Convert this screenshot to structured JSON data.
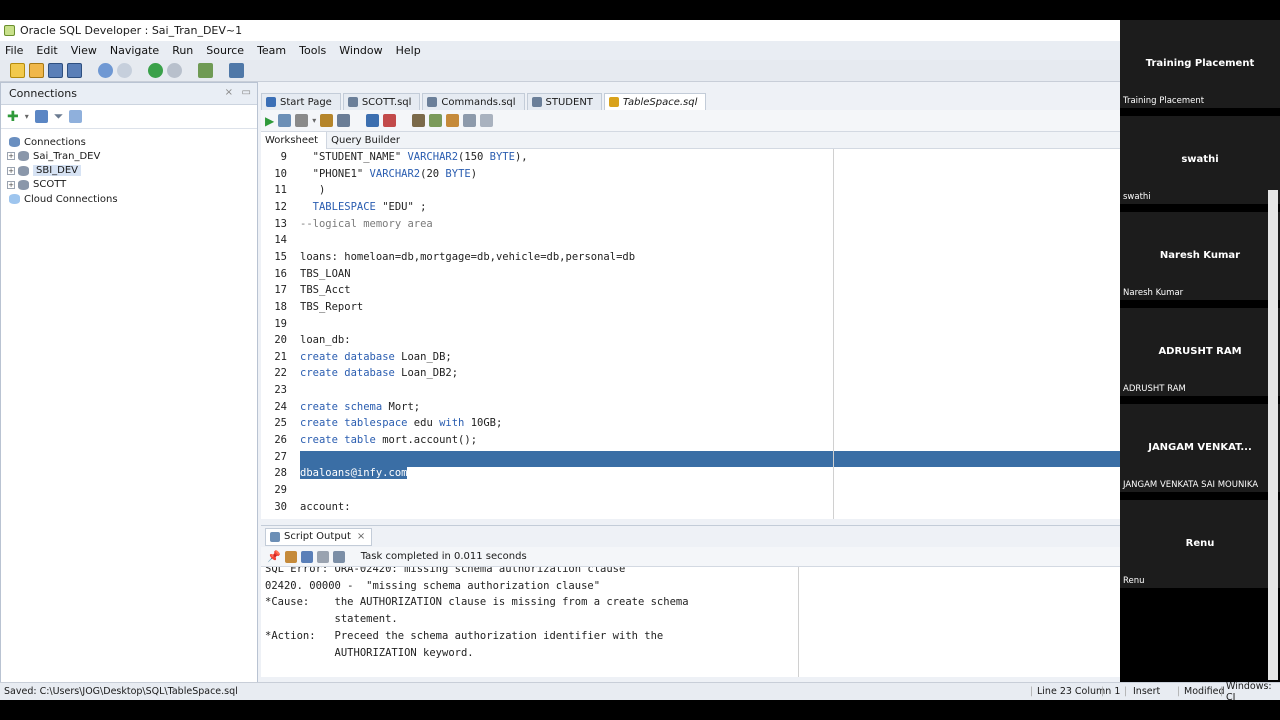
{
  "window": {
    "title": "Oracle SQL Developer : Sai_Tran_DEV~1"
  },
  "menu": [
    "File",
    "Edit",
    "View",
    "Navigate",
    "Run",
    "Source",
    "Team",
    "Tools",
    "Window",
    "Help"
  ],
  "connections_panel": {
    "title": "Connections",
    "tree": [
      {
        "label": "Connections",
        "level": 0
      },
      {
        "label": "Sai_Tran_DEV",
        "level": 1
      },
      {
        "label": "SBI_DEV",
        "level": 1,
        "selected": true
      },
      {
        "label": "SCOTT",
        "level": 1
      },
      {
        "label": "Cloud Connections",
        "level": 0
      }
    ]
  },
  "editor_tabs": [
    {
      "label": "Start Page",
      "icon_color": "#3b6fb6"
    },
    {
      "label": "SCOTT.sql",
      "icon_color": "#6b7f99"
    },
    {
      "label": "Commands.sql",
      "icon_color": "#6b7f99"
    },
    {
      "label": "STUDENT",
      "icon_color": "#6b7f99"
    },
    {
      "label": "TableSpace.sql",
      "icon_color": "#d9a21b",
      "active": true
    }
  ],
  "subtabs": {
    "worksheet": "Worksheet",
    "query_builder": "Query Builder"
  },
  "editor": {
    "lines": [
      {
        "n": "9",
        "parts": [
          {
            "t": "  \"STUDENT_NAME\" "
          },
          {
            "t": "VARCHAR2",
            "c": "kw"
          },
          {
            "t": "(150 "
          },
          {
            "t": "BYTE",
            "c": "kw"
          },
          {
            "t": "),"
          }
        ]
      },
      {
        "n": "10",
        "parts": [
          {
            "t": "  \"PHONE1\" "
          },
          {
            "t": "VARCHAR2",
            "c": "kw"
          },
          {
            "t": "(20 "
          },
          {
            "t": "BYTE",
            "c": "kw"
          },
          {
            "t": ")"
          }
        ]
      },
      {
        "n": "11",
        "parts": [
          {
            "t": "   )"
          }
        ]
      },
      {
        "n": "12",
        "parts": [
          {
            "t": "  "
          },
          {
            "t": "TABLESPACE",
            "c": "kw"
          },
          {
            "t": " \"EDU\" ;"
          }
        ]
      },
      {
        "n": "13",
        "parts": [
          {
            "t": "--logical memory area",
            "c": "cmt"
          }
        ]
      },
      {
        "n": "14",
        "parts": [
          {
            "t": ""
          }
        ]
      },
      {
        "n": "15",
        "parts": [
          {
            "t": "loans: homeloan=db,mortgage=db,vehicle=db,personal=db"
          }
        ]
      },
      {
        "n": "16",
        "parts": [
          {
            "t": "TBS_LOAN"
          }
        ]
      },
      {
        "n": "17",
        "parts": [
          {
            "t": "TBS_Acct"
          }
        ]
      },
      {
        "n": "18",
        "parts": [
          {
            "t": "TBS_Report"
          }
        ]
      },
      {
        "n": "19",
        "parts": [
          {
            "t": ""
          }
        ]
      },
      {
        "n": "20",
        "parts": [
          {
            "t": "loan_db:"
          }
        ]
      },
      {
        "n": "21",
        "parts": [
          {
            "t": "create",
            "c": "kw"
          },
          {
            "t": " "
          },
          {
            "t": "database",
            "c": "kw"
          },
          {
            "t": " Loan_DB;"
          }
        ]
      },
      {
        "n": "22",
        "parts": [
          {
            "t": "create",
            "c": "kw"
          },
          {
            "t": " "
          },
          {
            "t": "database",
            "c": "kw"
          },
          {
            "t": " Loan_DB2;"
          }
        ]
      },
      {
        "n": "23",
        "parts": [
          {
            "t": ""
          }
        ]
      },
      {
        "n": "24",
        "parts": [
          {
            "t": "create",
            "c": "kw"
          },
          {
            "t": " "
          },
          {
            "t": "schema",
            "c": "kw"
          },
          {
            "t": " Mort;"
          }
        ]
      },
      {
        "n": "25",
        "parts": [
          {
            "t": "create",
            "c": "kw"
          },
          {
            "t": " "
          },
          {
            "t": "tablespace",
            "c": "kw"
          },
          {
            "t": " edu "
          },
          {
            "t": "with",
            "c": "kw"
          },
          {
            "t": " 10GB;"
          }
        ]
      },
      {
        "n": "26",
        "parts": [
          {
            "t": "create",
            "c": "kw"
          },
          {
            "t": " "
          },
          {
            "t": "table",
            "c": "kw"
          },
          {
            "t": " mort.account();"
          }
        ]
      },
      {
        "n": "27",
        "parts": [
          {
            "t": ""
          }
        ],
        "highlight": true
      },
      {
        "n": "28",
        "parts": [
          {
            "t": "dbaloans@infy.com",
            "c": "selcode"
          }
        ]
      },
      {
        "n": "29",
        "parts": [
          {
            "t": ""
          }
        ]
      },
      {
        "n": "30",
        "parts": [
          {
            "t": "account:"
          }
        ]
      }
    ]
  },
  "script_output": {
    "tab_label": "Script Output",
    "status": "Task completed in 0.011 seconds",
    "lines": [
      "SQL Error: ORA-02420: missing schema authorization clause",
      "02420. 00000 -  \"missing schema authorization clause\"",
      "*Cause:    the AUTHORIZATION clause is missing from a create schema",
      "           statement.",
      "*Action:   Preceed the schema authorization identifier with the",
      "           AUTHORIZATION keyword."
    ]
  },
  "statusbar": {
    "saved": "Saved: C:\\Users\\JOG\\Desktop\\SQL\\TableSpace.sql",
    "position": "Line 23 Column 1",
    "mode": "Insert",
    "modified": "Modified",
    "eol": "Windows: CI"
  },
  "participants": [
    {
      "name": "Training Placement",
      "sub": "Training Placement"
    },
    {
      "name": "swathi",
      "sub": "swathi"
    },
    {
      "name": "Naresh Kumar",
      "sub": "Naresh Kumar"
    },
    {
      "name": "ADRUSHT RAM",
      "sub": "ADRUSHT RAM"
    },
    {
      "name": "JANGAM  VENKAT...",
      "sub": "JANGAM VENKATA SAI MOUNIKA"
    },
    {
      "name": "Renu",
      "sub": "Renu"
    }
  ],
  "colors": {
    "accent": "#3a6ea5",
    "keyword": "#2a5db0",
    "panel_bg": "#eef1f6"
  }
}
